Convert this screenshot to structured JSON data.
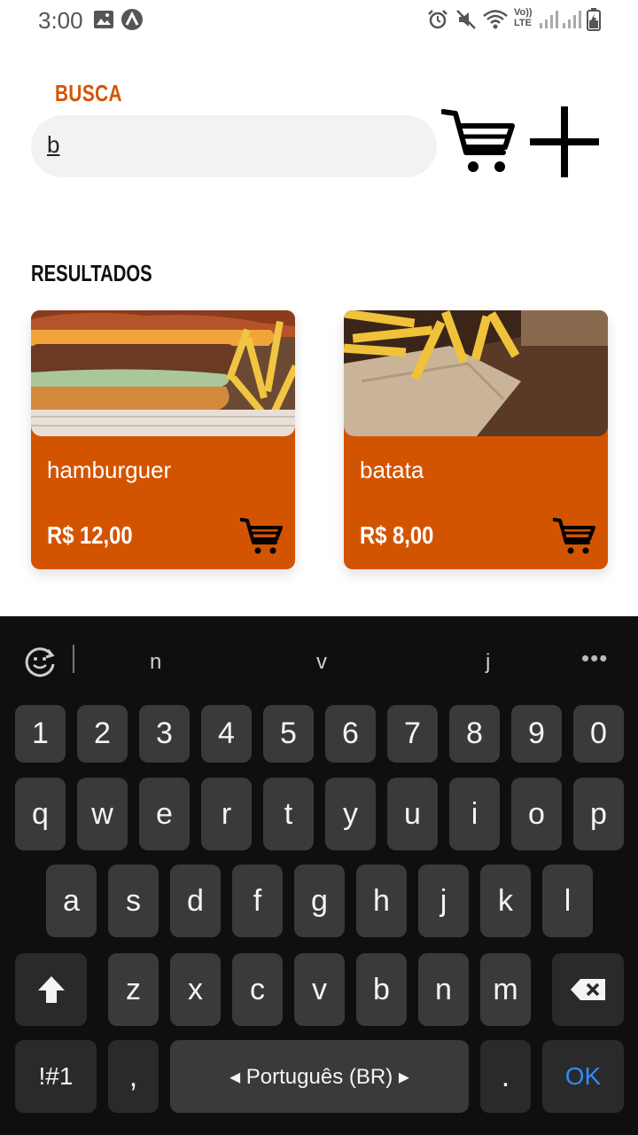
{
  "status_bar": {
    "time": "3:00",
    "icons": [
      "image-icon",
      "app-icon",
      "alarm-icon",
      "mute-icon",
      "wifi-icon",
      "volte-icon",
      "signal-icon",
      "signal-icon-2",
      "battery-icon"
    ],
    "volte_text_1": "Vo))",
    "volte_text_2": "LTE"
  },
  "header": {
    "search_label": "BUSCA",
    "search_value": "b"
  },
  "results": {
    "label": "RESULTADOS",
    "items": [
      {
        "name": "hamburguer",
        "price": "R$ 12,00"
      },
      {
        "name": "batata",
        "price": "R$ 8,00"
      }
    ]
  },
  "keyboard": {
    "suggestions": [
      "n",
      "v",
      "j"
    ],
    "more": "•••",
    "row_numbers": [
      "1",
      "2",
      "3",
      "4",
      "5",
      "6",
      "7",
      "8",
      "9",
      "0"
    ],
    "row_1": [
      "q",
      "w",
      "e",
      "r",
      "t",
      "y",
      "u",
      "i",
      "o",
      "p"
    ],
    "row_2": [
      "a",
      "s",
      "d",
      "f",
      "g",
      "h",
      "j",
      "k",
      "l"
    ],
    "row_3": [
      "z",
      "x",
      "c",
      "v",
      "b",
      "n",
      "m"
    ],
    "symbols_key": "!#1",
    "comma_key": ",",
    "space_label": "◂ Português (BR) ▸",
    "period_key": ".",
    "ok_key": "OK"
  },
  "colors": {
    "accent": "#d35400",
    "keyboard_bg": "#0f0f0f",
    "key_bg": "#3a3a3c",
    "ok_blue": "#2f8cf0"
  }
}
